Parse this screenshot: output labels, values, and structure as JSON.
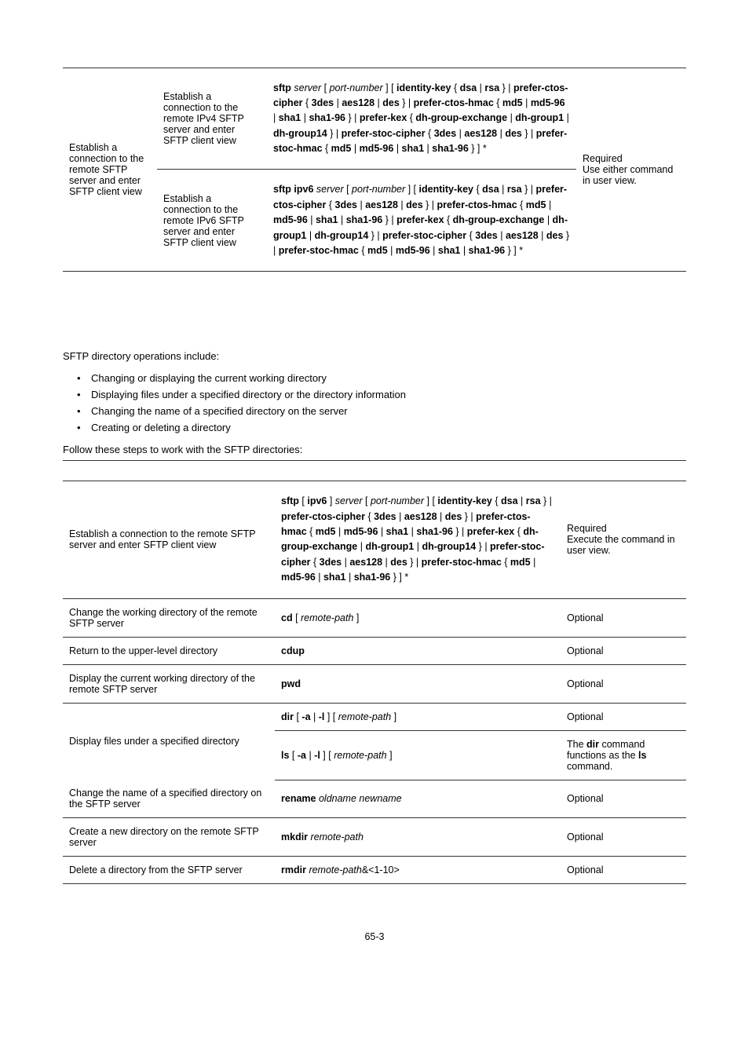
{
  "topTable": {
    "col1": "Establish a connection to the remote SFTP server and enter SFTP client view",
    "row1Desc": "Establish a connection to the remote IPv4 SFTP server and enter SFTP client view",
    "row2Desc": "Establish a connection to the remote IPv6 SFTP server and enter SFTP client view",
    "remarks": "Required\nUse either command in user view."
  },
  "syntaxTop1_pre": " ",
  "syntaxTop1_server": "server",
  "syntaxTop1_parts": " [ ",
  "syntaxTop1_port": "port-number",
  "syntaxTop1_parts2": " ] [ ",
  "syntaxTop1_idk": "identity-key",
  "syntaxTop1_parts3": " { ",
  "syntaxTop1_dsa": "dsa",
  "syntaxTop1_bar": " | ",
  "syntaxTop1_rsa": "rsa",
  "syntaxTop1_parts4": " } | ",
  "syntaxTop1_pc": "prefer-ctos-cipher",
  "syntaxTop1_parts5": " { ",
  "syntaxTop1_3des": "3des",
  "syntaxTop1_aes128": "aes128",
  "syntaxTop1_des": "des",
  "syntaxTop1_parts6": " } | ",
  "syntaxTop1_pch": "prefer-ctos-hmac",
  "syntaxTop1_parts7": " { ",
  "syntaxTop1_md5": "md5",
  "syntaxTop1_md596": "md5-96",
  "syntaxTop1_sha1": "sha1",
  "syntaxTop1_sha196": "sha1-96",
  "syntaxTop1_parts8": " } | ",
  "syntaxTop1_pk": "prefer-kex",
  "syntaxTop1_parts9": " { ",
  "syntaxTop1_dh1": "dh-group-exchange",
  "syntaxTop1_dh2": "dh-group1",
  "syntaxTop1_dh3": "dh-group14",
  "syntaxTop1_parts10": " } | ",
  "syntaxTop1_psc": "prefer-stoc-cipher",
  "syntaxTop1_parts11": " { ",
  "syntaxTop1_parts12": " } | ",
  "syntaxTop1_psh": "prefer-stoc-hmac",
  "syntaxTop1_parts13": " { ",
  "syntaxTop1_parts14": " } ] *",
  "sftp2_kw": "sftp ipv6",
  "intro": "SFTP directory operations include:",
  "bullets": [
    "Changing or displaying the current working directory",
    "Displaying files under a specified directory or the directory information",
    "Changing the name of a specified directory on the server",
    "Creating or deleting a directory"
  ],
  "follow": "Follow these steps to work with the SFTP directories:",
  "dirTable": {
    "rows": [
      {
        "desc": "Establish a connection to the remote SFTP server and enter SFTP client view",
        "rem": "Required\nExecute the command in user view."
      },
      {
        "desc": "Change the working directory of the remote SFTP server",
        "cmdKw": "cd",
        "cmdRest": " [ ",
        "cmdArg": "remote-path",
        "cmdRest2": " ]",
        "rem": "Optional"
      },
      {
        "desc": "Return to the upper-level directory",
        "cmdKw": "cdup",
        "rem": "Optional"
      },
      {
        "desc": "Display the current working directory of the remote SFTP server",
        "cmdKw": "pwd",
        "rem": "Optional"
      },
      {
        "desc": "Display files under a specified directory",
        "cmd1Kw": "dir",
        "cmd1a": " [ ",
        "cmd1b": "-a",
        "cmd1c": " | ",
        "cmd1d": "-l",
        "cmd1e": " ] [ ",
        "cmd1Arg": "remote-path",
        "cmd1f": " ]",
        "cmd2Kw": "ls",
        "rem1": "Optional",
        "rem2a": "The ",
        "rem2b": "dir",
        "rem2c": " command functions as the ",
        "rem2d": "ls",
        "rem2e": " command."
      },
      {
        "desc": "Change the name of a specified directory on the SFTP server",
        "cmdKw": "rename",
        "cmdSp": " ",
        "cmdArg1": "oldname",
        "cmdArg2": "newname",
        "rem": "Optional"
      },
      {
        "desc": "Create a new directory on the remote SFTP server",
        "cmdKw": "mkdir",
        "cmdSp": " ",
        "cmdArg": "remote-path",
        "rem": "Optional"
      },
      {
        "desc": "Delete a directory from the SFTP server",
        "cmdKw": "rmdir",
        "cmdSp": " ",
        "cmdArg": "remote-path",
        "cmdRest": "&<1-10>",
        "rem": "Optional"
      }
    ]
  },
  "pagenum": "65-3"
}
